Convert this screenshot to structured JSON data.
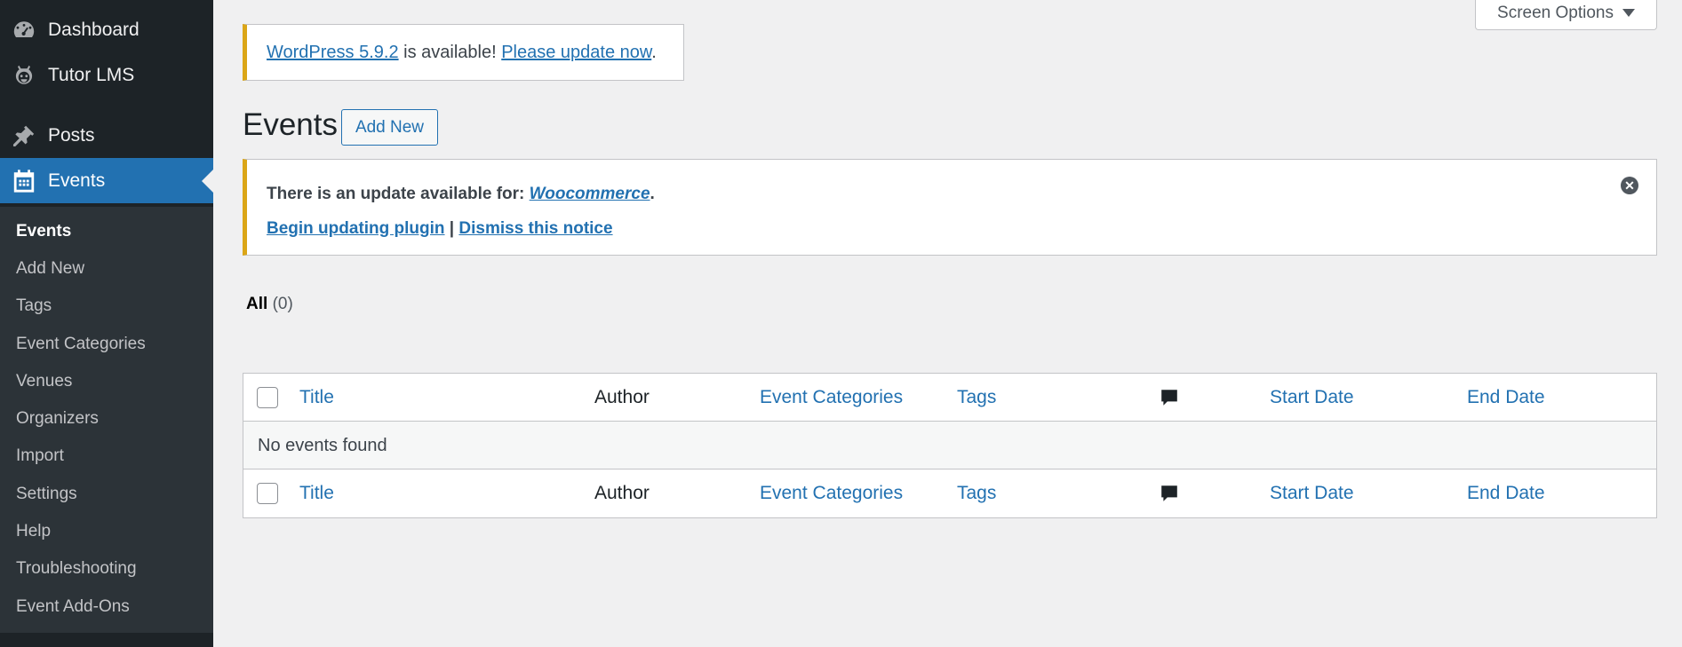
{
  "sidebar": {
    "items": [
      {
        "label": "Dashboard",
        "icon": "dashboard-icon"
      },
      {
        "label": "Tutor LMS",
        "icon": "tutor-lms-icon"
      },
      {
        "label": "Posts",
        "icon": "pin-icon"
      },
      {
        "label": "Events",
        "icon": "calendar-icon"
      }
    ],
    "submenu": [
      "Events",
      "Add New",
      "Tags",
      "Event Categories",
      "Venues",
      "Organizers",
      "Import",
      "Settings",
      "Help",
      "Troubleshooting",
      "Event Add-Ons"
    ]
  },
  "screen_options": "Screen Options",
  "wp_notice": {
    "link1": "WordPress 5.9.2",
    "middle": " is available! ",
    "link2": "Please update now",
    "end": "."
  },
  "page": {
    "title": "Events",
    "add_new": "Add New"
  },
  "plugin_notice": {
    "prefix": "There is an update available for: ",
    "plugin": "Woocommerce",
    "suffix": ".",
    "begin": "Begin updating plugin",
    "sep": " | ",
    "dismiss": "Dismiss this notice"
  },
  "filters": {
    "all_label": "All",
    "all_count": "(0)"
  },
  "table": {
    "columns": [
      "Title",
      "Author",
      "Event Categories",
      "Tags",
      "Start Date",
      "End Date"
    ],
    "empty_message": "No events found"
  },
  "colors": {
    "sidebar_bg": "#1d2327",
    "active": "#2271b1",
    "notice_warning": "#dba617",
    "link": "#2271b1"
  }
}
